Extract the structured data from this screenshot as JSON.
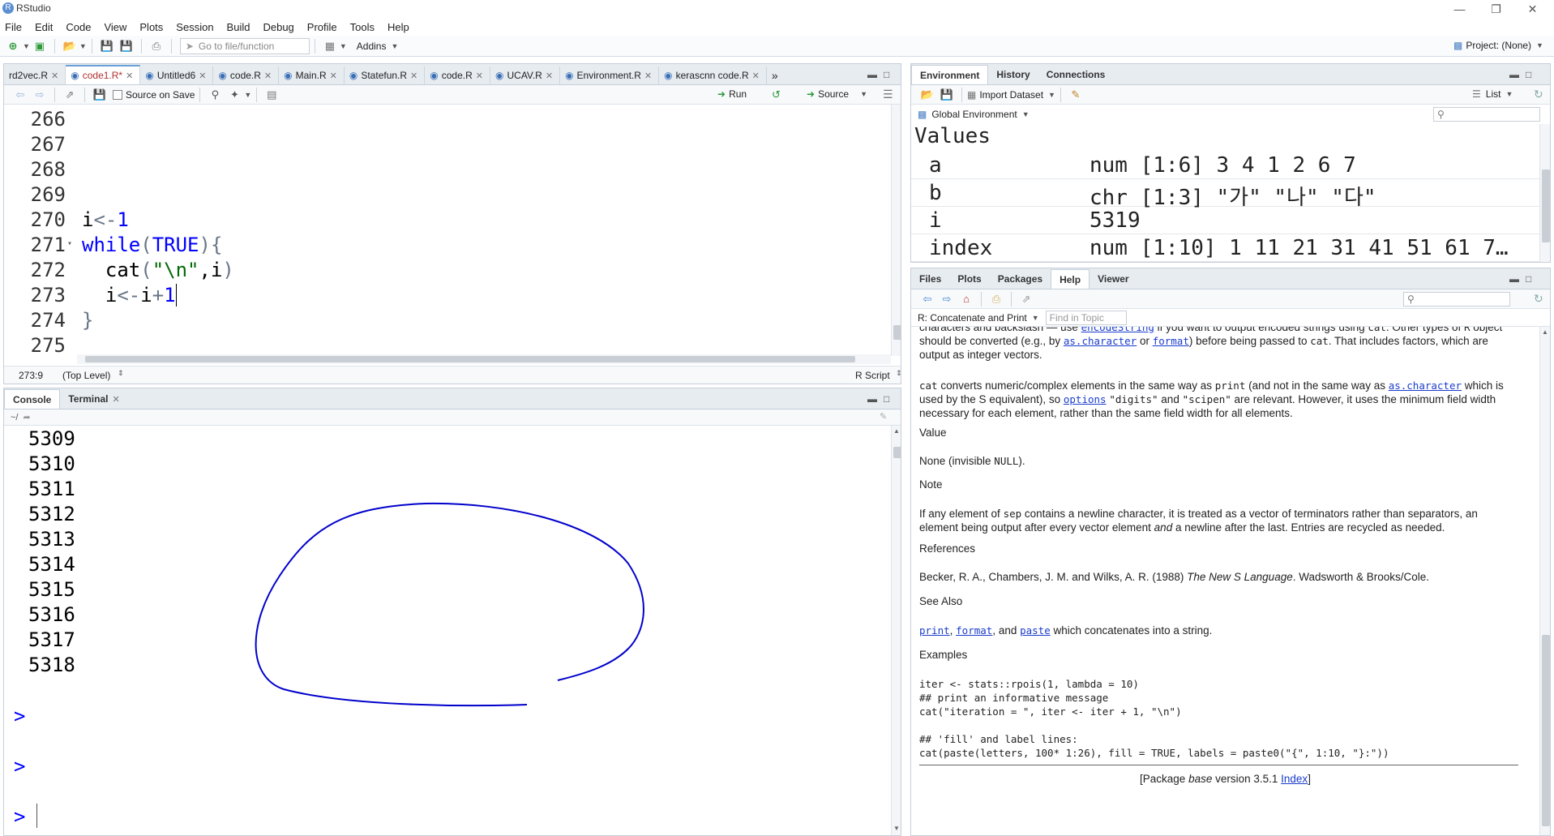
{
  "window": {
    "title": "RStudio",
    "project": "Project: (None)"
  },
  "menu": [
    "File",
    "Edit",
    "Code",
    "View",
    "Plots",
    "Session",
    "Build",
    "Debug",
    "Profile",
    "Tools",
    "Help"
  ],
  "toolbar": {
    "goto_placeholder": "Go to file/function",
    "addins": "Addins"
  },
  "editor": {
    "tabs": [
      "rd2vec.R",
      "code1.R*",
      "Untitled6",
      "code.R",
      "Main.R",
      "Statefun.R",
      "code.R",
      "UCAV.R",
      "Environment.R",
      "kerascnn code.R"
    ],
    "source_on_save": "Source on Save",
    "run_label": "Run",
    "source_label": "Source",
    "line_numbers": [
      "266",
      "267",
      "268",
      "269",
      "270",
      "271",
      "272",
      "273",
      "274",
      "275"
    ],
    "status_position": "273:9",
    "status_scope": "(Top Level)",
    "status_type": "R Script"
  },
  "console": {
    "tabs": [
      "Console",
      "Terminal"
    ],
    "path": "~/",
    "output": [
      "5309",
      "5310",
      "5311",
      "5312",
      "5313",
      "5314",
      "5315",
      "5316",
      "5317",
      "5318"
    ],
    "prompt": ">"
  },
  "environment": {
    "tabs": [
      "Environment",
      "History",
      "Connections"
    ],
    "import_label": "Import Dataset",
    "list_label": "List",
    "scope": "Global Environment",
    "section": "Values",
    "rows": [
      {
        "name": "a",
        "value": "num [1:6] 3 4 1 2 6 7"
      },
      {
        "name": "b",
        "value": "chr [1:3] \"가\" \"나\" \"다\""
      },
      {
        "name": "i",
        "value": "5319"
      },
      {
        "name": "index",
        "value": "num [1:10] 1 11 21 31 41 51 61 7…"
      }
    ]
  },
  "help": {
    "tabs": [
      "Files",
      "Plots",
      "Packages",
      "Help",
      "Viewer"
    ],
    "topic": "R: Concatenate and Print",
    "find_placeholder": "Find in Topic",
    "value_heading": "Value",
    "note_heading": "Note",
    "references_heading": "References",
    "see_also_heading": "See Also",
    "examples_heading": "Examples",
    "value_text": "None (invisible NULL).",
    "see_also_text": "which concatenates into a string.",
    "footer": "[Package base version 3.5.1 Index]"
  }
}
